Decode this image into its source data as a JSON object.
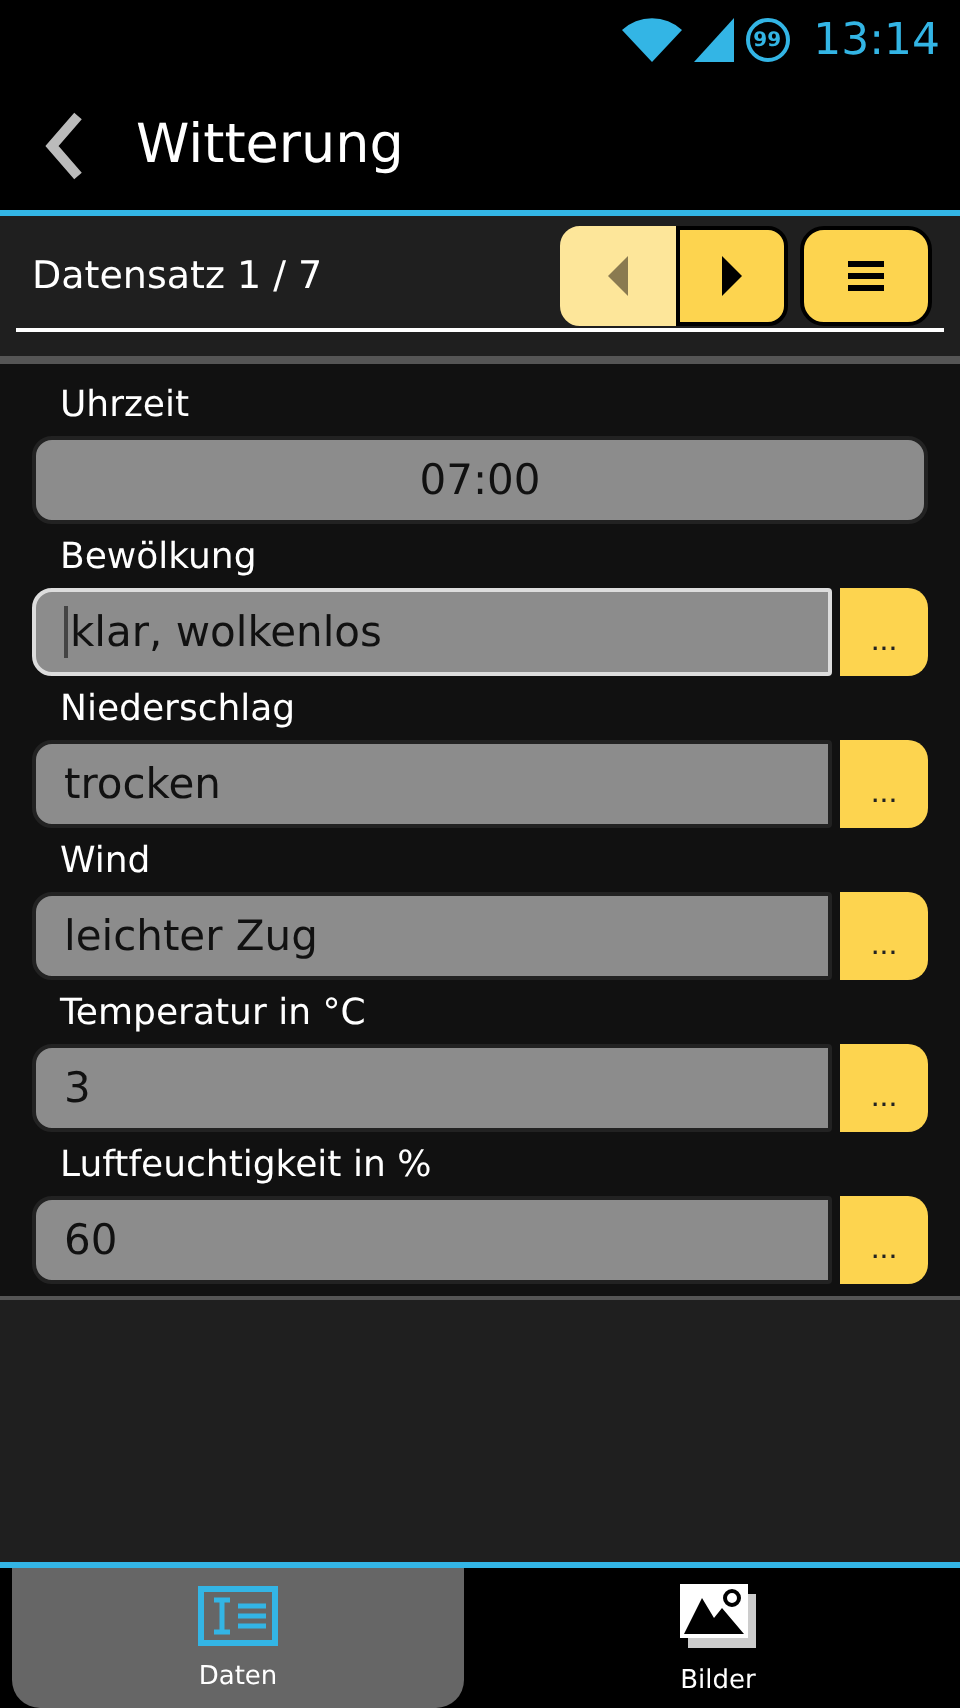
{
  "status_bar": {
    "time": "13:14",
    "notification_badge": "99"
  },
  "action_bar": {
    "title": "Witterung"
  },
  "record_bar": {
    "label": "Datensatz 1 / 7",
    "prev_disabled": true,
    "next_disabled": false
  },
  "fields": [
    {
      "label": "Uhrzeit",
      "value": "07:00",
      "kind": "time",
      "focused": false
    },
    {
      "label": "Bewölkung",
      "value": "klar, wolkenlos",
      "kind": "choice",
      "focused": true,
      "button": "..."
    },
    {
      "label": "Niederschlag",
      "value": "trocken",
      "kind": "choice",
      "focused": false,
      "button": "..."
    },
    {
      "label": "Wind",
      "value": "leichter Zug",
      "kind": "choice",
      "focused": false,
      "button": "..."
    },
    {
      "label": "Temperatur in °C",
      "value": "3",
      "kind": "choice",
      "focused": false,
      "button": "..."
    },
    {
      "label": "Luftfeuchtigkeit in %",
      "value": "60",
      "kind": "choice",
      "focused": false,
      "button": "..."
    }
  ],
  "tabs": [
    {
      "label": "Daten",
      "selected": true,
      "kind": "data"
    },
    {
      "label": "Bilder",
      "selected": false,
      "kind": "images"
    }
  ]
}
